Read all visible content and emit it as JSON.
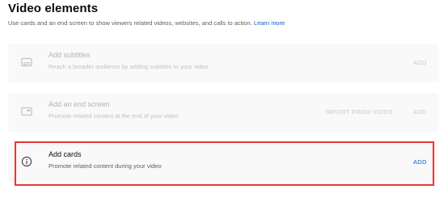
{
  "header": {
    "title": "Video elements",
    "subtitle": "Use cards and an end screen to show viewers related videos, websites, and calls to action.",
    "learn_more": "Learn more"
  },
  "elements": [
    {
      "title": "Add subtitles",
      "description": "Reach a broader audience by adding subtitles to your video",
      "icon": "subtitles-icon",
      "action": "ADD",
      "enabled": false
    },
    {
      "title": "Add an end screen",
      "description": "Promote related content at the end of your video",
      "icon": "end-screen-icon",
      "secondary_action": "IMPORT FROM VIDEO",
      "action": "ADD",
      "enabled": false
    },
    {
      "title": "Add cards",
      "description": "Promote related content during your video",
      "icon": "info-icon",
      "action": "ADD",
      "enabled": true,
      "highlighted": true
    }
  ],
  "colors": {
    "accent": "#065fd4",
    "highlight_border": "#e53935",
    "card_background": "#f9f9f9"
  }
}
